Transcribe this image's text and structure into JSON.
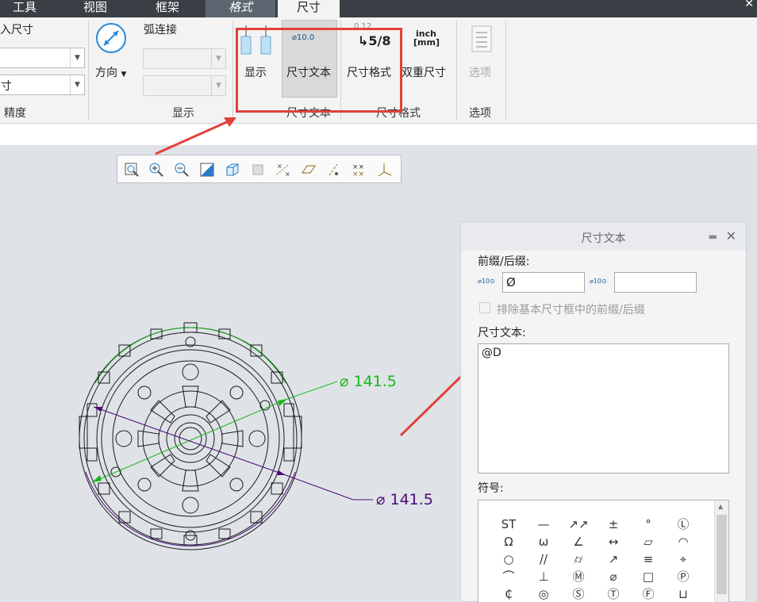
{
  "tabs": {
    "tools": "工具",
    "view": "视图",
    "frame": "框架",
    "format": "格式",
    "dimension": "尺寸"
  },
  "ribbon": {
    "input_dim_label": "入尺寸",
    "combo2_value": "寸",
    "precision_group": "精度",
    "direction_label": "方向",
    "arc_connect_label": "弧连接",
    "display_group": "显示",
    "show_button": "显示",
    "dim_text_button": "尺寸文本",
    "dim_text_icon": "⌀10.0",
    "dim_text_group": "尺寸文本",
    "dim_format_button": "尺寸格式",
    "dim_format_icon_top": "0.12",
    "dim_format_icon_frac": "5/8",
    "dim_format_group": "尺寸格式",
    "dual_dim_icon_top": "inch",
    "dual_dim_icon_bottom": "[mm]",
    "dual_dim_button": "双重尺寸",
    "options_button": "选项",
    "options_group": "选项"
  },
  "graphics_toolbar": {
    "icons": [
      "zoom-refit-icon",
      "zoom-in-icon",
      "zoom-out-icon",
      "repaint-icon",
      "display-style-icon",
      "saved-views-icon",
      "datum-display-icon",
      "plane-display-icon",
      "axis-display-icon",
      "point-display-icon",
      "csys-display-icon"
    ]
  },
  "drawing": {
    "dim_green": "⌀ 141.5",
    "dim_purple": "⌀ 141.5",
    "green_color": "#17b817",
    "purple_color": "#4b0a78"
  },
  "panel": {
    "title": "尺寸文本",
    "prefix_suffix_label": "前缀/后缀:",
    "prefix_icon": "⌀10⊙",
    "prefix_value": "Ø",
    "suffix_icon": "⌀10⊙",
    "suffix_value": "",
    "exclude_checkbox_label": "排除基本尺寸框中的前缀/后缀",
    "dim_text_label": "尺寸文本:",
    "dim_text_value": "@D",
    "symbols_label": "符号:",
    "symbols": [
      "ST",
      "—",
      "↗↗",
      "±",
      "°",
      "Ⓛ",
      "Ω",
      "ω",
      "∠",
      "↔",
      "▱",
      "◠",
      "○",
      "//",
      "⌭",
      "↗",
      "≡",
      "⌖",
      "⌒",
      "⊥",
      "Ⓜ",
      "⌀",
      "□",
      "Ⓟ",
      "₵",
      "◎",
      "Ⓢ",
      "Ⓣ",
      "Ⓕ",
      "⊔"
    ]
  },
  "annotation": {
    "box_color": "#e2403a",
    "arrow_color": "#e2403a"
  }
}
